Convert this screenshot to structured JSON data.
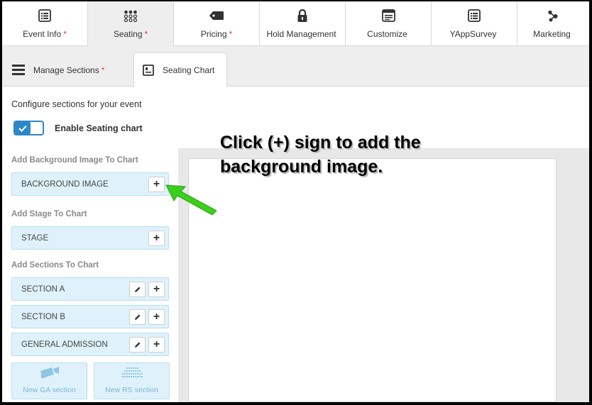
{
  "top_tabs": [
    {
      "label": "Event Info",
      "required": "*",
      "icon": "list-icon"
    },
    {
      "label": "Seating",
      "required": "*",
      "icon": "seating-dots-icon"
    },
    {
      "label": "Pricing",
      "required": "*",
      "icon": "price-tag-icon"
    },
    {
      "label": "Hold Management",
      "required": "",
      "icon": "lock-icon"
    },
    {
      "label": "Customize",
      "required": "",
      "icon": "browser-window-icon"
    },
    {
      "label": "YAppSurvey",
      "required": "",
      "icon": "survey-list-icon"
    },
    {
      "label": "Marketing",
      "required": "",
      "icon": "share-nodes-icon"
    }
  ],
  "active_top_tab": "Seating",
  "sub_tabs": [
    {
      "label": "Manage Sections",
      "required": "*",
      "icon": "hamburger-icon"
    },
    {
      "label": "Seating Chart",
      "required": "",
      "icon": "chart-document-icon"
    }
  ],
  "active_sub_tab": "Seating Chart",
  "config_text": "Configure sections for your event",
  "toggle": {
    "label": "Enable Seating chart",
    "checked": true
  },
  "background": {
    "heading": "Add Background Image To Chart",
    "item": "BACKGROUND IMAGE",
    "add_label": "+"
  },
  "stage": {
    "heading": "Add Stage To Chart",
    "item": "STAGE",
    "add_label": "+"
  },
  "sections": {
    "heading": "Add Sections To Chart",
    "items": [
      "SECTION A",
      "SECTION B",
      "GENERAL ADMISSION"
    ],
    "add_label": "+"
  },
  "new_buttons": [
    {
      "label": "New GA section",
      "icon": "camera-icon"
    },
    {
      "label": "New RS section",
      "icon": "seat-grid-icon"
    }
  ],
  "annotation": {
    "line1": "Click (+) sign to add the",
    "line2": "background image."
  },
  "colors": {
    "accent": "#2c86c9",
    "required": "#e23b3b",
    "item_bg": "#dff2fb",
    "arrow": "#3ccf1e"
  }
}
